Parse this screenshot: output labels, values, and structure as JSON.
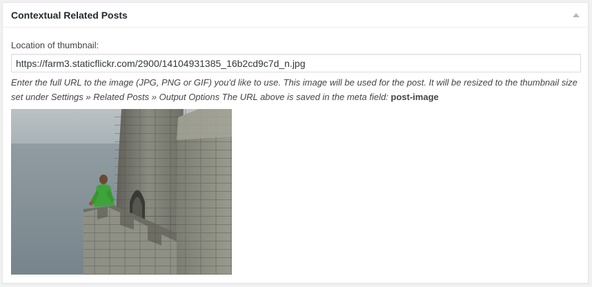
{
  "metabox": {
    "title": "Contextual Related Posts",
    "toggle_icon": "triangle-up-icon"
  },
  "field": {
    "label": "Location of thumbnail:",
    "value": "https://farm3.staticflickr.com/2900/14104931385_16b2cd9c7d_n.jpg",
    "description": "Enter the full URL to the image (JPG, PNG or GIF) you'd like to use. This image will be used for the post. It will be resized to the thumbnail size set under Settings » Related Posts » Output Options The URL above is saved in the meta field: ",
    "meta_field": "post-image"
  },
  "colors": {
    "title": "#23282d",
    "text": "#444444",
    "border": "#e5e5e5"
  }
}
